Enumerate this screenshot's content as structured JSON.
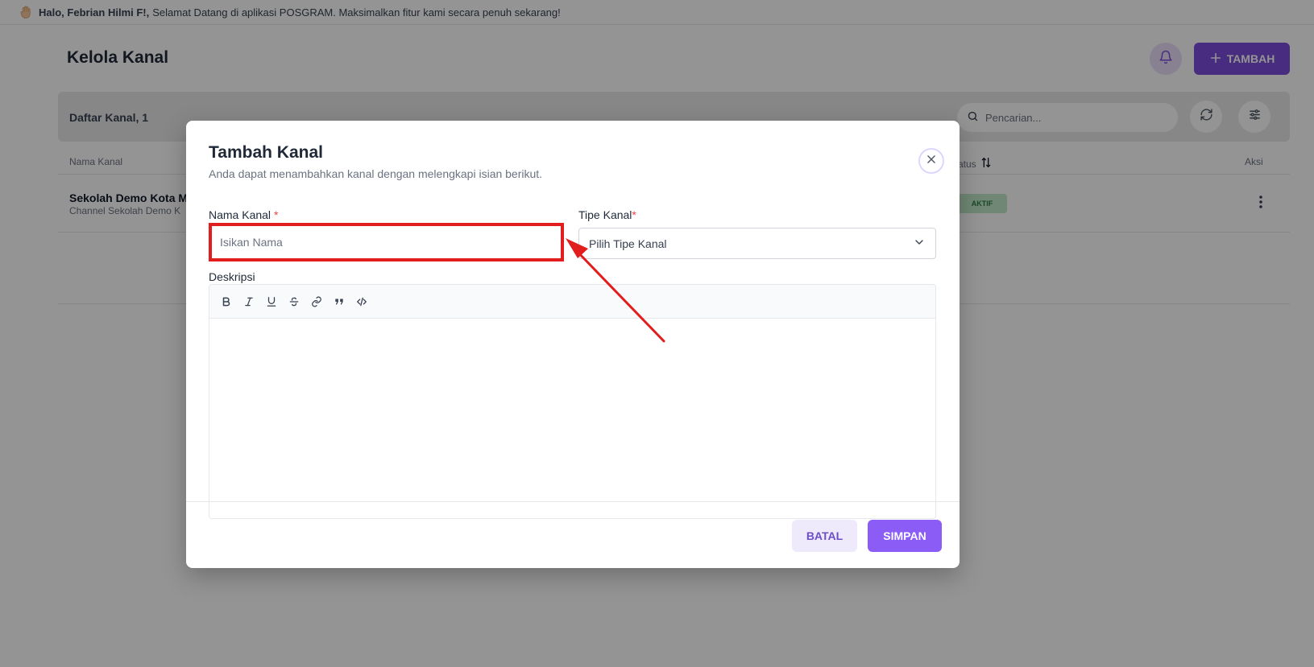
{
  "greeting": {
    "name": "Halo, Febrian Hilmi F!,",
    "message": "Selamat Datang di aplikasi POSGRAM. Maksimalkan fitur kami secara penuh sekarang!"
  },
  "page": {
    "title": "Kelola Kanal",
    "add_label": "TAMBAH"
  },
  "list": {
    "title": "Daftar Kanal, 1",
    "search_placeholder": "Pencarian..."
  },
  "table": {
    "columns": {
      "name": "Nama Kanal",
      "status": "atus",
      "action": "Aksi"
    },
    "rows": [
      {
        "name": "Sekolah Demo Kota M",
        "sub": "Channel Sekolah Demo K",
        "status": "AKTIF"
      }
    ]
  },
  "modal": {
    "title": "Tambah Kanal",
    "subtitle": "Anda dapat menambahkan kanal dengan melengkapi isian berikut.",
    "name_label": "Nama Kanal",
    "name_req": "*",
    "name_placeholder": "Isikan Nama",
    "type_label": "Tipe Kanal",
    "type_req": "*",
    "type_placeholder": "Pilih Tipe Kanal",
    "desc_label": "Deskripsi",
    "cancel_label": "BATAL",
    "save_label": "SIMPAN"
  },
  "colors": {
    "accent": "#7c4ddb",
    "highlight": "#e11d1d",
    "status_active": "#bfe8c9"
  }
}
